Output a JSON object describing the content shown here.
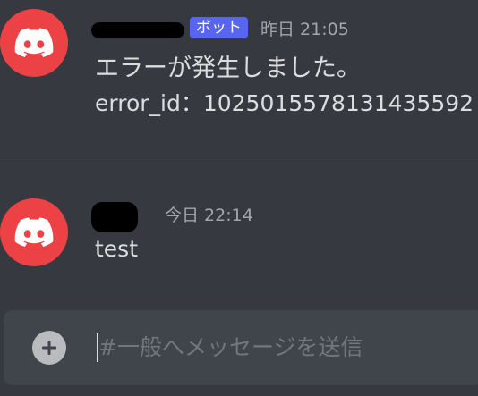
{
  "messages": [
    {
      "author_redacted": true,
      "bot_tag": "ボット",
      "timestamp": "昨日 21:05",
      "lines": [
        "エラーが発生しました。",
        "error_id：1025015578131435592"
      ]
    },
    {
      "author_redacted": true,
      "timestamp": "今日 22:14",
      "lines": [
        "test"
      ]
    }
  ],
  "composer": {
    "placeholder": "#一般へメッセージを送信",
    "value": ""
  },
  "colors": {
    "background": "#36393f",
    "avatar": "#ed4245",
    "bot_tag": "#5865f2",
    "composer": "#40444b"
  },
  "icons": {
    "avatar": "discord-logo-icon",
    "add": "plus-circle-icon"
  }
}
